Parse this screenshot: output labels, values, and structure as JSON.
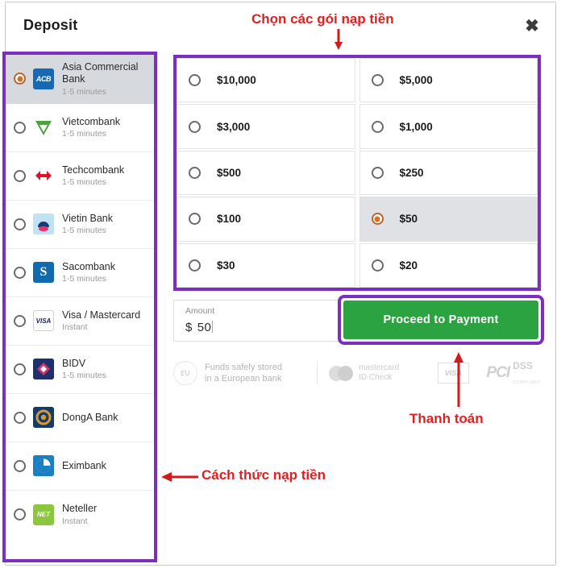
{
  "modal": {
    "title": "Deposit",
    "close_label": "✖"
  },
  "banks": {
    "items": [
      {
        "name": "Asia Commercial Bank",
        "sub": "1-5 minutes",
        "selected": true,
        "logo": "acb-logo",
        "logo_class": "lg-acb",
        "logo_text": "ACB"
      },
      {
        "name": "Vietcombank",
        "sub": "1-5 minutes",
        "selected": false,
        "logo": "vietcombank-logo",
        "logo_class": "lg-vcb",
        "logo_text": ""
      },
      {
        "name": "Techcombank",
        "sub": "1-5 minutes",
        "selected": false,
        "logo": "techcombank-logo",
        "logo_class": "lg-tcb",
        "logo_text": ""
      },
      {
        "name": "Vietin Bank",
        "sub": "1-5 minutes",
        "selected": false,
        "logo": "vietinbank-logo",
        "logo_class": "lg-vtb",
        "logo_text": ""
      },
      {
        "name": "Sacombank",
        "sub": "1-5 minutes",
        "selected": false,
        "logo": "sacombank-logo",
        "logo_class": "lg-scb",
        "logo_text": "S"
      },
      {
        "name": "Visa / Mastercard",
        "sub": "Instant",
        "selected": false,
        "logo": "visa-logo",
        "logo_class": "lg-visa",
        "logo_text": "VISA"
      },
      {
        "name": "BIDV",
        "sub": "1-5 minutes",
        "selected": false,
        "logo": "bidv-logo",
        "logo_class": "lg-bidv",
        "logo_text": ""
      },
      {
        "name": "DongA Bank",
        "sub": "",
        "selected": false,
        "logo": "donga-logo",
        "logo_class": "lg-dab",
        "logo_text": ""
      },
      {
        "name": "Eximbank",
        "sub": "",
        "selected": false,
        "logo": "eximbank-logo",
        "logo_class": "lg-exb",
        "logo_text": ""
      },
      {
        "name": "Neteller",
        "sub": "Instant",
        "selected": false,
        "logo": "neteller-logo",
        "logo_class": "lg-net",
        "logo_text": "NET"
      }
    ]
  },
  "amounts": {
    "options": [
      {
        "label": "$10,000",
        "selected": false
      },
      {
        "label": "$5,000",
        "selected": false
      },
      {
        "label": "$3,000",
        "selected": false
      },
      {
        "label": "$1,000",
        "selected": false
      },
      {
        "label": "$500",
        "selected": false
      },
      {
        "label": "$250",
        "selected": false
      },
      {
        "label": "$100",
        "selected": false
      },
      {
        "label": "$50",
        "selected": true
      },
      {
        "label": "$30",
        "selected": false
      },
      {
        "label": "$20",
        "selected": false
      }
    ]
  },
  "amount_input": {
    "label": "Amount",
    "currency": "$",
    "value": "50"
  },
  "payment": {
    "button_label": "Proceed to Payment"
  },
  "badges": {
    "eu_mark": "EU",
    "eu_line1": "Funds safely stored",
    "eu_line2": "in a European bank",
    "mastercard_line1": "mastercard",
    "mastercard_line2": "ID Check",
    "visa_label": "VISA",
    "pci_mark": "PCI",
    "pci_dss": "DSS",
    "pci_sub": "COMPLIANT"
  },
  "annotations": {
    "top": "Chọn các gói nạp tiền",
    "payment": "Thanh toán",
    "methods": "Cách thức nạp tiền"
  },
  "colors": {
    "highlight_purple": "#7b2fbe",
    "annotation_red": "#e01f1f",
    "pay_green": "#2aa340",
    "radio_orange": "#d2711f"
  }
}
